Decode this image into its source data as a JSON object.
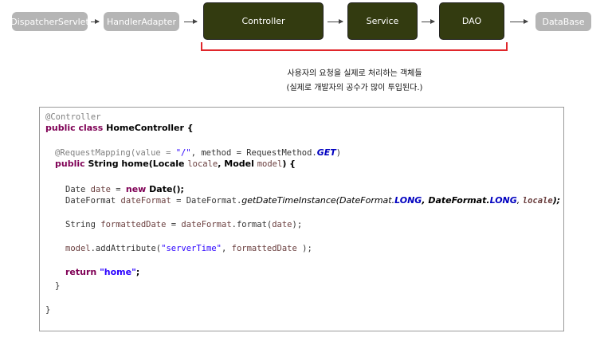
{
  "flow": {
    "dispatcher": "DispatcherServlet",
    "handler_adapter": "HandlerAdapter",
    "controller": "Controller",
    "service": "Service",
    "dao": "DAO",
    "database": "DataBase"
  },
  "note": {
    "line1": "사용자의 요청을 실제로 처리하는 객체들",
    "line2": "(실제로 개발자의 공수가 많이 투입된다.)"
  },
  "code": {
    "l1": "@Controller",
    "l2_kw": "public class ",
    "l2_name": "HomeController {",
    "l3_ann": "@RequestMapping(value = ",
    "l3_str": "\"/\"",
    "l3_mid": ", method = RequestMethod.",
    "l3_const": "GET",
    "l3_end": ")",
    "l4_kw": "public ",
    "l4_a": "String home(Locale ",
    "l4_var1": "locale",
    "l4_b": ", Model ",
    "l4_var2": "model",
    "l4_end": ") {",
    "l5_a": "Date ",
    "l5_var": "date",
    "l5_b": " = ",
    "l5_kw": "new ",
    "l5_end": "Date();",
    "l6_a": "DateFormat ",
    "l6_var": "dateFormat",
    "l6_b": " = DateFormat.",
    "l6_m": "getDateTimeInstance(DateFormat.",
    "l6_c1": "LONG",
    "l6_c": ", DateFormat.",
    "l6_c2": "LONG",
    "l6_d": ", ",
    "l6_var2": "locale",
    "l6_end": ");",
    "l7_a": "String ",
    "l7_var": "formattedDate",
    "l7_b": " = ",
    "l7_var2": "dateFormat",
    "l7_c": ".format(",
    "l7_var3": "date",
    "l7_end": ");",
    "l8_var": "model",
    "l8_a": ".addAttribute(",
    "l8_str": "\"serverTime\"",
    "l8_b": ", ",
    "l8_var2": "formattedDate",
    "l8_end": " );",
    "l9_kw": "return ",
    "l9_str": "\"home\"",
    "l9_end": ";",
    "l10": "}",
    "l11": "}"
  }
}
